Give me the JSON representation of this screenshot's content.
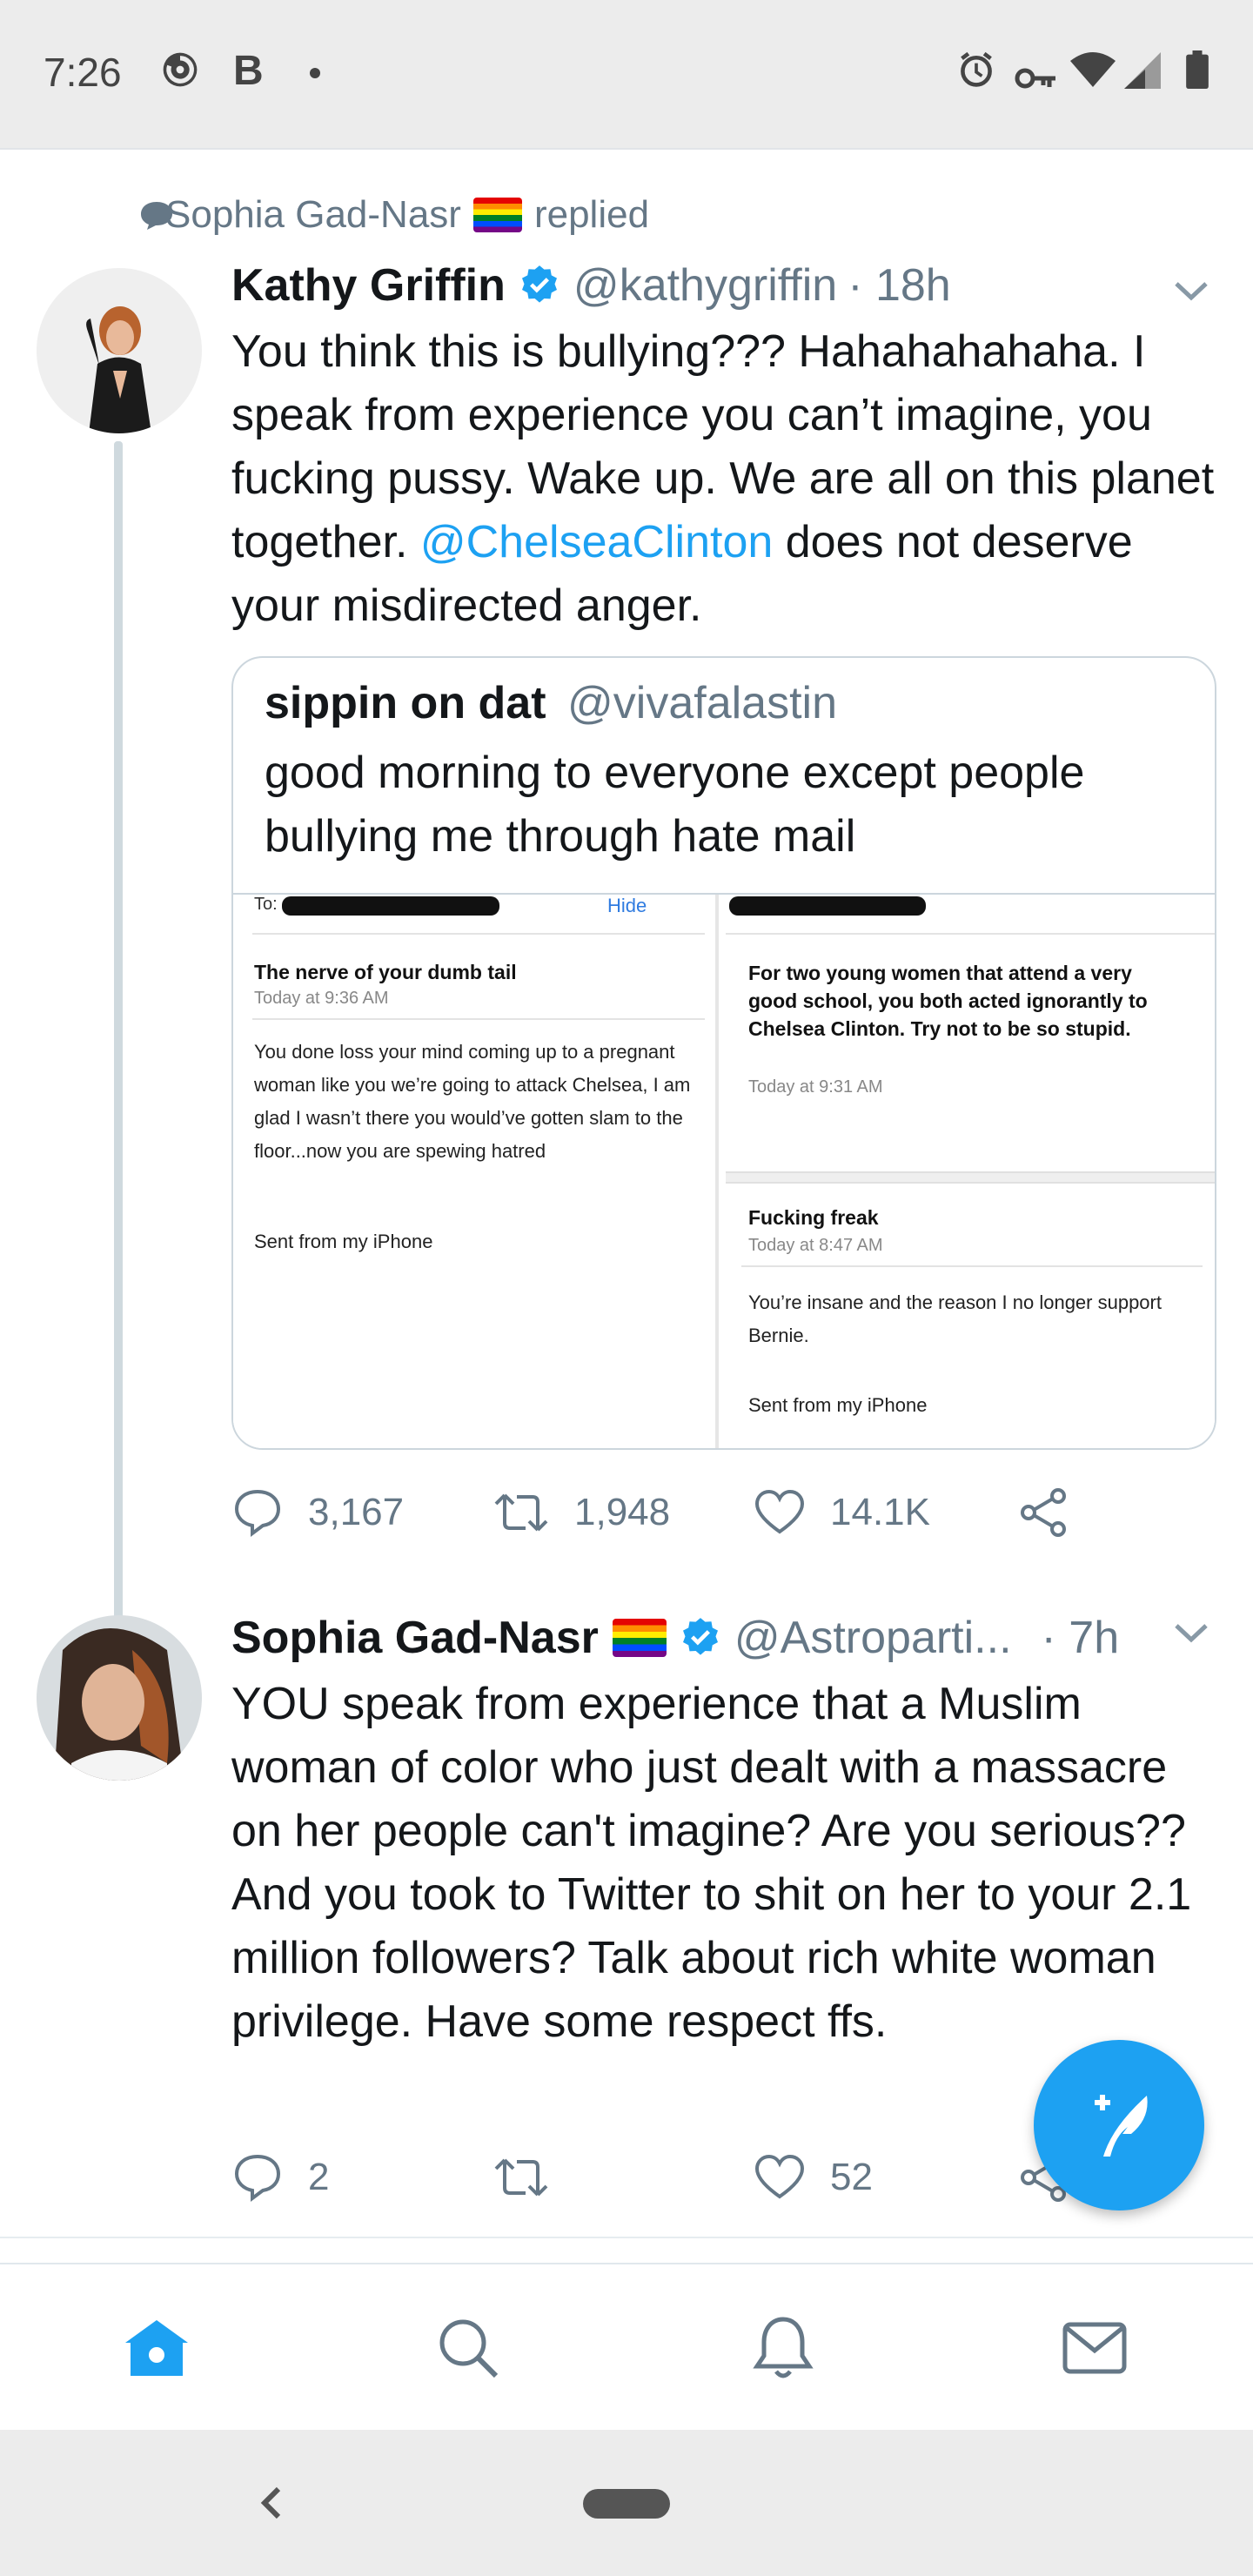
{
  "status_bar": {
    "time": "7:26",
    "b_letter": "B"
  },
  "social_context": {
    "name": "Sophia Gad-Nasr",
    "action": "replied"
  },
  "tweet1": {
    "name": "Kathy Griffin",
    "handle": "@kathygriffin",
    "time": "· 18h",
    "text_part1": "You think this is bullying??? Hahahahahaha. I speak from experience you can’t imagine, you fucking pussy. Wake up. We are all on this planet together. ",
    "mention": "@ChelseaClinton",
    "text_part2": " does not deserve your misdirected anger.",
    "quote": {
      "name": "sippin on dat",
      "handle": "@vivafalastin",
      "text": "good morning to everyone except people bullying me through hate mail",
      "mail_left": {
        "to_label": "To:",
        "hide_label": "Hide",
        "subject": "The nerve of your dumb tail",
        "date": "Today at 9:36 AM",
        "body": "You done loss your mind coming up to a pregnant woman like you we’re going to attack Chelsea, I am glad I wasn’t there you would’ve gotten slam to the floor...now you are spewing hatred",
        "signature": "Sent from my iPhone"
      },
      "mail_right_top": {
        "body": "For two young women that attend a very good school, you both acted ignorantly to Chelsea Clinton. Try not to be so stupid.",
        "date": "Today at 9:31 AM"
      },
      "mail_right_bottom": {
        "subject": "Fucking freak",
        "date": "Today at 8:47 AM",
        "body": "You’re insane and the reason I no longer support Bernie.",
        "signature": "Sent from my iPhone"
      }
    },
    "replies": "3,167",
    "retweets": "1,948",
    "likes": "14.1K"
  },
  "tweet2": {
    "name": "Sophia Gad-Nasr",
    "handle": "@Astroparti...",
    "time": "· 7h",
    "text": "YOU speak from experience that a Muslim woman of color who just dealt with a massacre on her people can't imagine? Are you serious?? And you took to Twitter to shit on her to your 2.1 million followers? Talk about  rich white woman privilege. Have some respect ffs.",
    "replies": "2",
    "retweets": "",
    "likes": "52"
  },
  "colors": {
    "accent": "#1da1f2",
    "secondary_text": "#657786",
    "primary_text": "#14171a"
  },
  "icons": [
    "reply-icon",
    "retweet-icon",
    "like-icon",
    "share-icon",
    "verified-icon",
    "compose-icon",
    "home-icon",
    "search-icon",
    "notifications-icon",
    "messages-icon"
  ]
}
